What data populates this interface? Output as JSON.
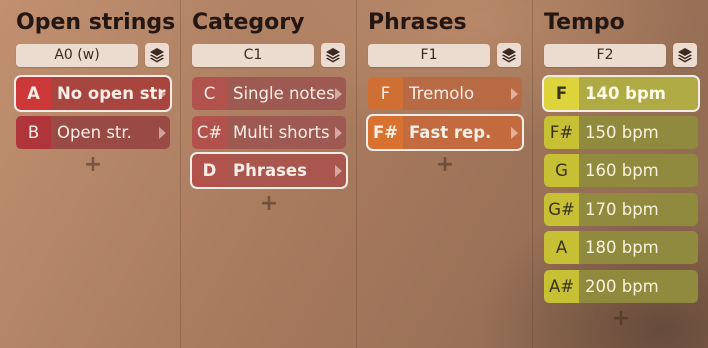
{
  "columns": [
    {
      "title": "Open strings",
      "field": "A0 (w)",
      "items": [
        {
          "key": "A",
          "label": "No open str",
          "selected": true
        },
        {
          "key": "B",
          "label": "Open str.",
          "selected": false
        }
      ],
      "add": "+"
    },
    {
      "title": "Category",
      "field": "C1",
      "items": [
        {
          "key": "C",
          "label": "Single notes",
          "selected": false
        },
        {
          "key": "C#",
          "label": "Multi shorts",
          "selected": false
        },
        {
          "key": "D",
          "label": "Phrases",
          "selected": true
        }
      ],
      "add": "+"
    },
    {
      "title": "Phrases",
      "field": "F1",
      "items": [
        {
          "key": "F",
          "label": "Tremolo",
          "selected": false
        },
        {
          "key": "F#",
          "label": "Fast rep.",
          "selected": true
        }
      ],
      "add": "+"
    },
    {
      "title": "Tempo",
      "field": "F2",
      "items": [
        {
          "key": "F",
          "label": "140 bpm",
          "selected": true
        },
        {
          "key": "F#",
          "label": "150 bpm",
          "selected": false
        },
        {
          "key": "G",
          "label": "160 bpm",
          "selected": false
        },
        {
          "key": "G#",
          "label": "170 bpm",
          "selected": false
        },
        {
          "key": "A",
          "label": "180 bpm",
          "selected": false
        },
        {
          "key": "A#",
          "label": "200 bpm",
          "selected": false
        }
      ],
      "add": "+"
    }
  ],
  "icons": {
    "layers": "layers-icon",
    "arrow": "chevron-right-icon",
    "add": "plus-icon"
  },
  "colors": {
    "red": "#cc3838",
    "rose": "#b2524c",
    "orange": "#d97230",
    "olive": "#dcd43a"
  }
}
